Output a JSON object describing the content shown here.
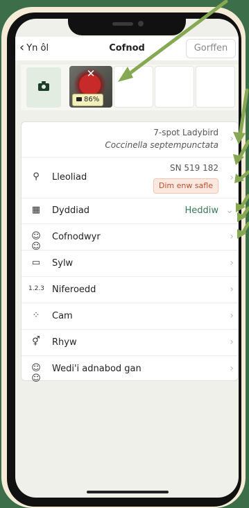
{
  "header": {
    "back_label": "Yn ôl",
    "title": "Cofnod",
    "finish_label": "Gorffen"
  },
  "photos": {
    "confidence_badge": "86%",
    "remove_glyph": "✕"
  },
  "species": {
    "common_name": "7-spot Ladybird",
    "scientific_name": "Coccinella septempunctata"
  },
  "rows": {
    "location": {
      "label": "Lleoliad",
      "grid_ref": "SN 519 182",
      "badge": "Dim enw safle"
    },
    "date": {
      "label": "Dyddiad",
      "value": "Heddiw"
    },
    "recorder": {
      "label": "Cofnodwyr"
    },
    "comment": {
      "label": "Sylw"
    },
    "number": {
      "label": "Niferoedd",
      "icon_text": "1.2.3"
    },
    "stage": {
      "label": "Cam"
    },
    "sex": {
      "label": "Rhyw"
    },
    "identifiers": {
      "label": "Wedi'i adnabod gan"
    }
  },
  "icons": {
    "back": "chevron-left-icon",
    "camera": "camera-icon",
    "location": "map-pin-icon",
    "date": "calendar-icon",
    "recorder": "people-icon",
    "comment": "clipboard-icon",
    "stage": "dots-icon",
    "sex": "gender-icon",
    "identifiers": "people-icon",
    "chevron": "chevron-right-icon"
  },
  "colors": {
    "background": "#3d6e4a",
    "accent": "#3a7a55",
    "badge_orange": "#bf4f30",
    "arrow": "#86a852"
  }
}
